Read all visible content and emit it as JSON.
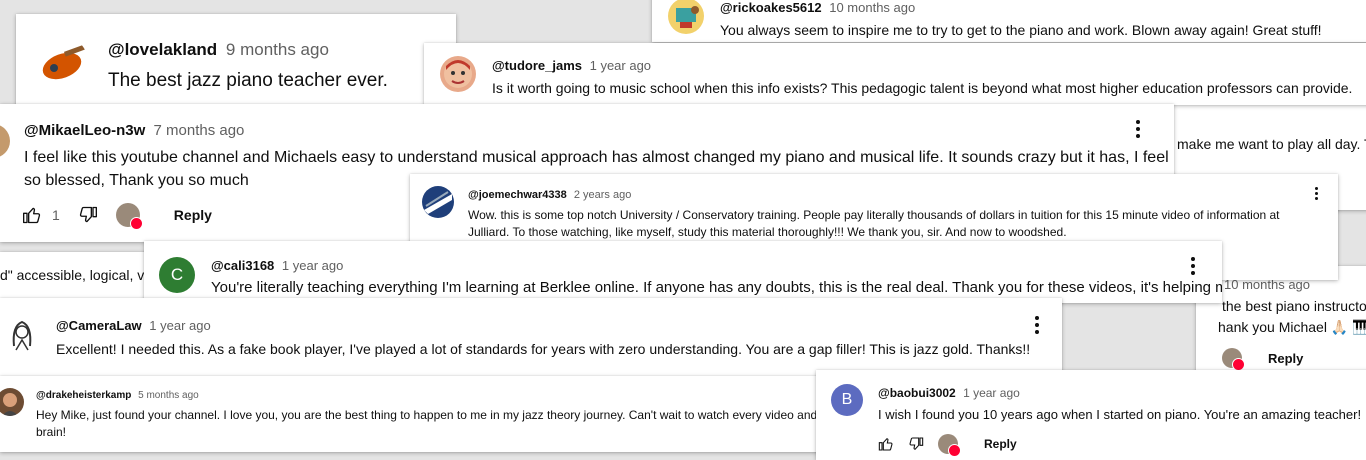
{
  "comments": {
    "rickoakes": {
      "handle": "@rickoakes5612",
      "time": "10 months ago",
      "text": "You always seem to inspire me to try to get to the piano and work. Blown away again! Great stuff!"
    },
    "lovelakland": {
      "handle": "@lovelakland",
      "time": "9 months ago",
      "text": "The best jazz piano teacher ever."
    },
    "tudore": {
      "handle": "@tudore_jams",
      "time": "1 year ago",
      "text": "Is it worth going to music school when this info exists? This pedagogic talent is beyond what most higher education professors can provide."
    },
    "partial_right": {
      "text": "make me want to play all day. T"
    },
    "mikaelleo": {
      "handle": "@MikaelLeo-n3w",
      "time": "7 months ago",
      "text": "I feel like this youtube channel and Michaels easy to understand musical approach has almost changed my piano and musical life. It sounds crazy but it has, I feel so blessed, Thank you so much",
      "likes": "1",
      "reply_label": "Reply"
    },
    "joemechwar": {
      "handle": "@joemechwar4338",
      "time": "2 years ago",
      "text": "Wow.  this is some top notch University / Conservatory training.  People pay literally thousands of dollars in tuition for this 15 minute video of information at Julliard. To those watching, like myself, study this material thoroughly!!!  We thank you, sir.  And now to woodshed."
    },
    "partial_left": {
      "text": "d\" accessible, logical, vi"
    },
    "cali3168": {
      "handle": "@cali3168",
      "time": "1 year ago",
      "text": "You're literally teaching everything I'm learning at Berklee online. If anyone has any doubts, this is the real deal. Thank you for these videos, it's helping me",
      "avatar_letter": "C"
    },
    "partial_right2": {
      "time": "10 months ago",
      "line1": "the best piano instructo",
      "line2": "hank you Michael 🙏🏻 🎹",
      "reply_label": "Reply"
    },
    "cameralaw": {
      "handle": "@CameraLaw",
      "time": "1 year ago",
      "text": "Excellent! I needed this. As a fake book player, I've played a lot of standards for years with zero understanding. You are a gap filler! This is jazz gold. Thanks!!"
    },
    "drakeheister": {
      "handle": "@drakeheisterkamp",
      "time": "5 months ago",
      "text": "Hey Mike, just found your channel. I love you, you are the best thing to happen to me in my jazz theory journey. Can't wait to watch every video and nouri",
      "text2": "brain!"
    },
    "baobui": {
      "handle": "@baobui3002",
      "time": "1 year ago",
      "text": "I wish I found you 10 years ago when I started on piano. You're an amazing teacher!",
      "avatar_letter": "B",
      "reply_label": "Reply"
    }
  },
  "colors": {
    "background": "#e4e4e4",
    "card": "#ffffff",
    "text": "#0f0f0f",
    "muted": "#606060",
    "heart": "#ff0033",
    "cali_avatar": "#2e7d32",
    "bao_avatar": "#5c6bc0"
  }
}
